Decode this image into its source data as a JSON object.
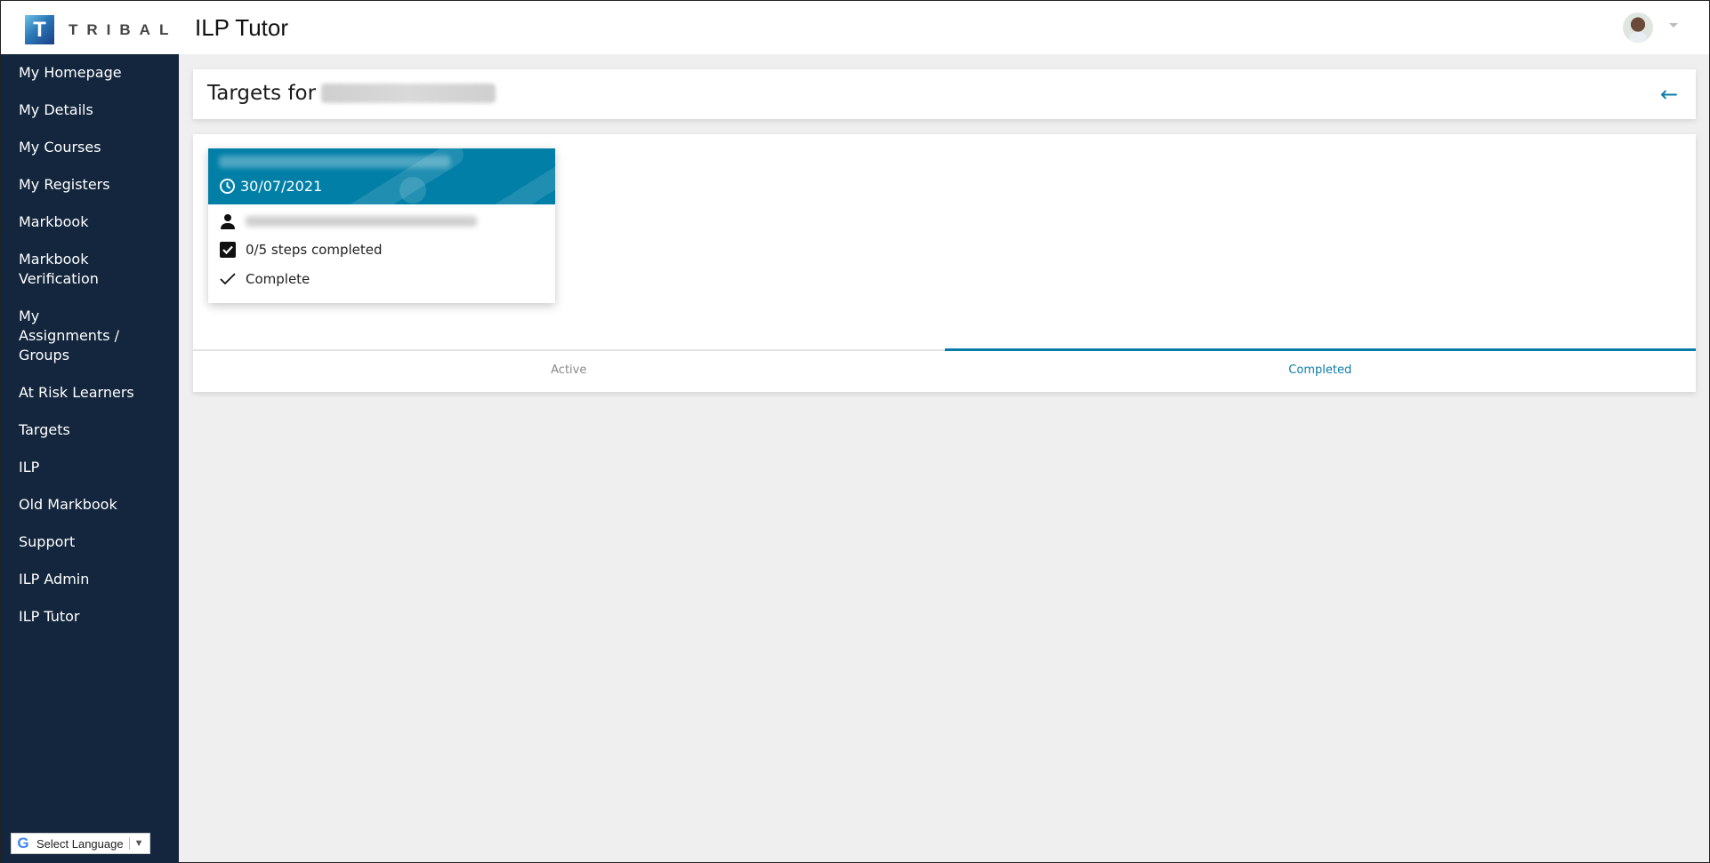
{
  "header": {
    "brand": "TRIBAL",
    "brand_mark": "T",
    "app_title": "ILP Tutor",
    "avatar": "user-avatar",
    "menu_caret": "chevron-down-icon"
  },
  "sidebar": {
    "items": [
      {
        "label": "My Homepage"
      },
      {
        "label": "My Details"
      },
      {
        "label": "My Courses"
      },
      {
        "label": "My Registers"
      },
      {
        "label": "Markbook"
      },
      {
        "label": "Markbook Verification"
      },
      {
        "label": "My Assignments / Groups"
      },
      {
        "label": "At Risk Learners"
      },
      {
        "label": "Targets"
      },
      {
        "label": "ILP"
      },
      {
        "label": "Old Markbook"
      },
      {
        "label": "Support"
      },
      {
        "label": "ILP Admin"
      },
      {
        "label": "ILP Tutor"
      }
    ],
    "language_selector": {
      "label": "Select Language",
      "icon": "G",
      "caret": "▼"
    }
  },
  "page": {
    "title_prefix": "Targets for",
    "title_name_redacted": true,
    "back_icon": "←"
  },
  "targets": [
    {
      "title_redacted": true,
      "date": "30/07/2021",
      "assignee_redacted": true,
      "steps": "0/5 steps completed",
      "status": "Complete"
    }
  ],
  "tabs": [
    {
      "label": "Active",
      "active": false
    },
    {
      "label": "Completed",
      "active": true
    }
  ],
  "colors": {
    "sidebar_bg": "#13263d",
    "accent": "#0a7ca8",
    "card_header": "#017fa7",
    "page_bg": "#efefef"
  }
}
